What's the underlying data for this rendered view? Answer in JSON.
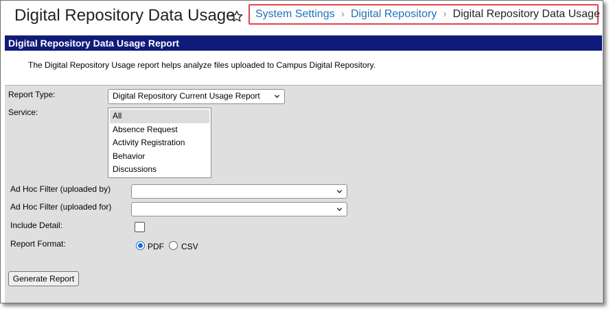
{
  "header": {
    "title": "Digital Repository Data Usage",
    "breadcrumb": {
      "items": [
        "System Settings",
        "Digital Repository"
      ],
      "current": "Digital Repository Data Usage"
    }
  },
  "panel": {
    "title": "Digital Repository Data Usage Report",
    "description": "The Digital Repository Usage report helps analyze files uploaded to Campus Digital Repository."
  },
  "form": {
    "report_type": {
      "label": "Report Type:",
      "value": "Digital Repository Current Usage Report"
    },
    "service": {
      "label": "Service:",
      "options": [
        "All",
        "Absence Request",
        "Activity Registration",
        "Behavior",
        "Discussions"
      ],
      "selected": "All"
    },
    "adhoc_by": {
      "label": "Ad Hoc Filter (uploaded by)",
      "value": ""
    },
    "adhoc_for": {
      "label": "Ad Hoc Filter (uploaded for)",
      "value": ""
    },
    "include_detail": {
      "label": "Include Detail:",
      "checked": false
    },
    "report_format": {
      "label": "Report Format:",
      "options": [
        "PDF",
        "CSV"
      ],
      "selected": "PDF"
    },
    "generate_label": "Generate Report"
  },
  "colors": {
    "panel_header_bg": "#0f1a7a",
    "link": "#1a72b8",
    "highlight_border": "#e0434b",
    "form_bg": "#dfdfdf"
  },
  "icons": {
    "favorite": "star-icon",
    "breadcrumb_separator": "chevron-right-icon",
    "dropdown": "chevron-down-icon"
  }
}
